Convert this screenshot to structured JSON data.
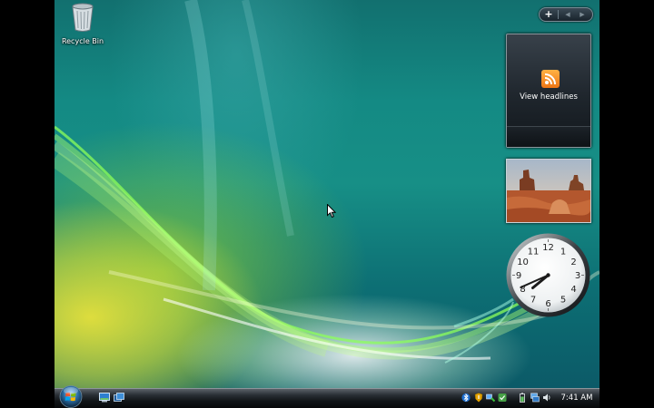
{
  "desktop": {
    "icons": [
      {
        "label": "Recycle Bin",
        "icon": "recycle-bin-icon"
      }
    ]
  },
  "sidebar": {
    "controls": {
      "add_label": "+",
      "prev_label": "◀",
      "next_label": "▶"
    },
    "feed_gadget": {
      "label": "View headlines",
      "icon": "rss-icon"
    },
    "slideshow_gadget": {
      "icon": "desert-photo"
    },
    "clock_gadget": {
      "numerals": [
        "12",
        "1",
        "2",
        "3",
        "4",
        "5",
        "6",
        "7",
        "8",
        "9",
        "10",
        "11"
      ],
      "time": "7:41"
    }
  },
  "taskbar": {
    "start_button": "windows-start-orb",
    "quick_launch": [
      {
        "icon": "show-desktop-icon"
      },
      {
        "icon": "switch-windows-icon"
      }
    ],
    "tray_icons": [
      "bluetooth-icon",
      "security-shield-icon",
      "network-status-icon",
      "windows-defender-icon",
      "battery-icon",
      "network-icon",
      "volume-icon"
    ],
    "clock": "7:41 AM"
  },
  "colors": {
    "rss_orange": "#f08a24",
    "taskbar_black": "#0b0e10",
    "wallpaper_teal": "#148a84",
    "wallpaper_yellow": "#e2de3c"
  }
}
